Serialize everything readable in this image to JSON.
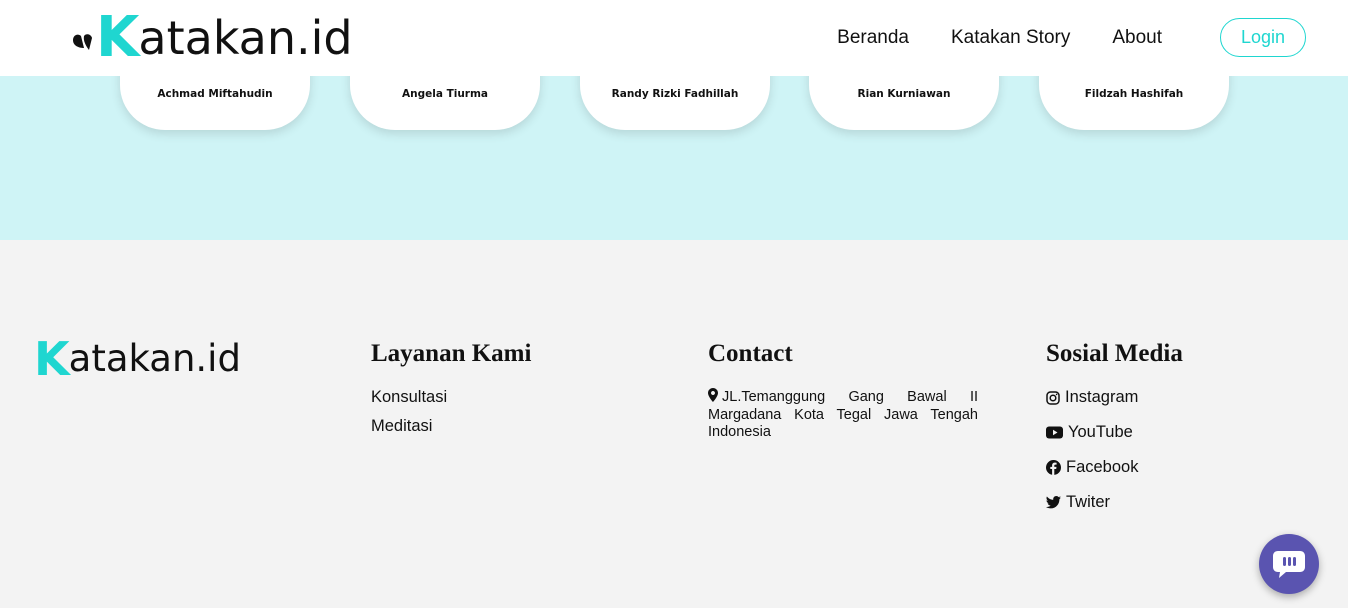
{
  "header": {
    "brand_k": "K",
    "brand_rest": "atakan.id",
    "nav": [
      {
        "label": "Beranda"
      },
      {
        "label": "Katakan Story"
      },
      {
        "label": "About"
      }
    ],
    "login_label": "Login"
  },
  "team": [
    {
      "name": "Achmad Miftahudin"
    },
    {
      "name": "Angela Tiurma"
    },
    {
      "name": "Randy Rizki Fadhillah"
    },
    {
      "name": "Rian Kurniawan"
    },
    {
      "name": "Fildzah Hashifah"
    }
  ],
  "footer": {
    "brand_k": "K",
    "brand_rest": "atakan.id",
    "layanan": {
      "title": "Layanan Kami",
      "items": [
        {
          "label": "Konsultasi"
        },
        {
          "label": "Meditasi"
        }
      ]
    },
    "contact": {
      "title": "Contact",
      "address": "JL.Temanggung Gang Bawal II Margadana Kota Tegal Jawa Tengah Indonesia"
    },
    "sosial": {
      "title": "Sosial Media",
      "items": [
        {
          "label": "Instagram",
          "icon": "instagram-icon"
        },
        {
          "label": "YouTube",
          "icon": "youtube-icon"
        },
        {
          "label": "Facebook",
          "icon": "facebook-icon"
        },
        {
          "label": "Twiter",
          "icon": "twitter-icon"
        }
      ]
    }
  },
  "colors": {
    "accent": "#1fd6d0",
    "team_band": "#cff4f6",
    "footer_bg": "#f3f3f3",
    "chat_button": "#5a54b0"
  }
}
